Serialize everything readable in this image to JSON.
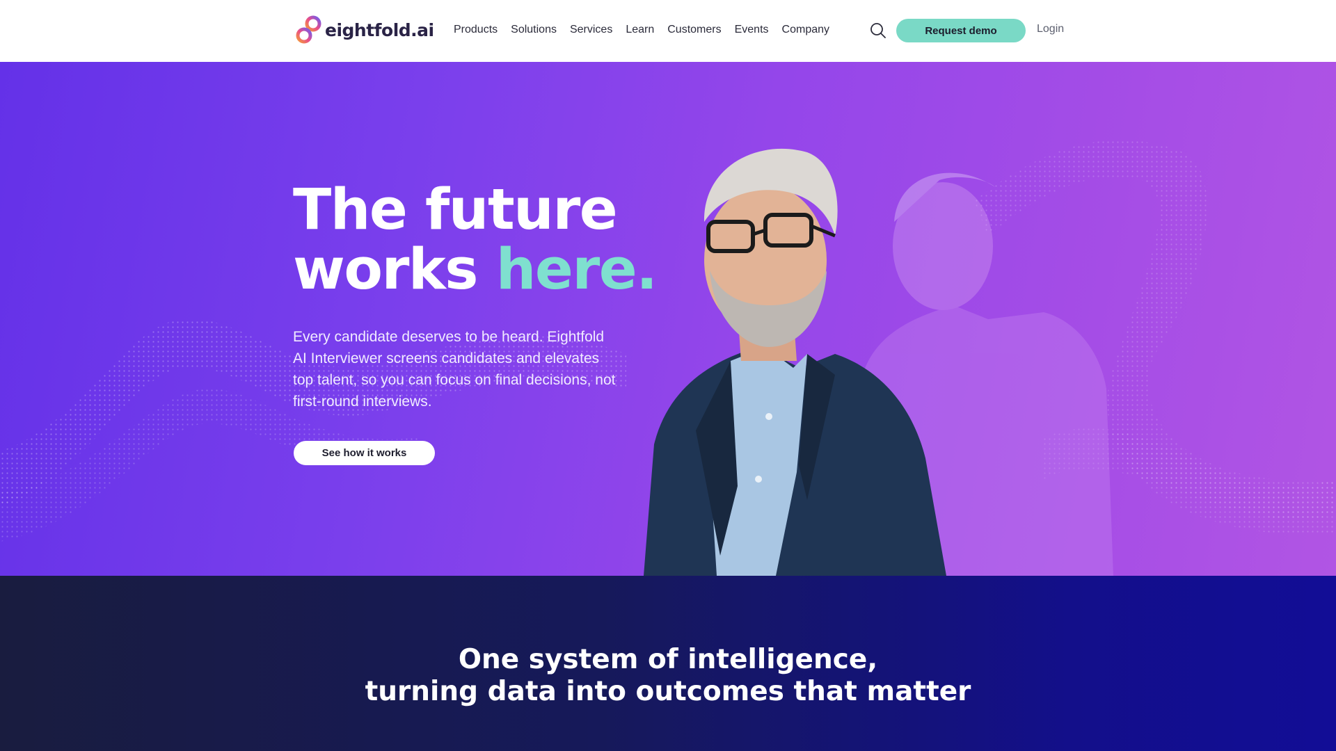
{
  "brand": {
    "name": "eightfold.ai"
  },
  "nav": {
    "items": [
      {
        "label": "Products"
      },
      {
        "label": "Solutions"
      },
      {
        "label": "Services"
      },
      {
        "label": "Learn"
      },
      {
        "label": "Customers"
      },
      {
        "label": "Events"
      },
      {
        "label": "Company"
      }
    ],
    "search_icon": "search-icon",
    "demo_label": "Request demo",
    "login_label": "Login"
  },
  "hero": {
    "title_line1": "The future",
    "title_line2_a": "works ",
    "title_line2_b": "here.",
    "description": "Every candidate deserves to be heard. Eightfold AI Interviewer screens candidates and elevates top talent, so you can focus on final decisions, not first-round interviews.",
    "cta_label": "See how it works"
  },
  "section2": {
    "title_line1": "One system of intelligence,",
    "title_line2": "turning data into outcomes that matter"
  },
  "colors": {
    "accent_teal": "#7ad9c6",
    "hero_purple": "#8a40ea",
    "dark_navy": "#16195a"
  }
}
